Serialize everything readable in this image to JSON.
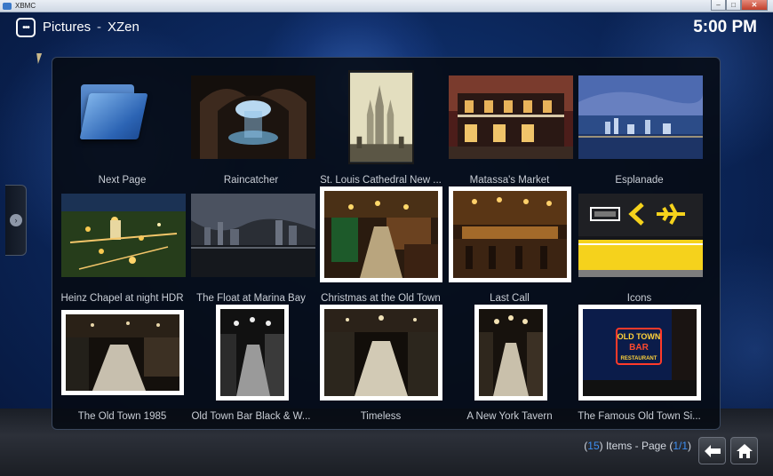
{
  "window": {
    "title": "XBMC",
    "buttons": {
      "minimize": "–",
      "maximize": "□",
      "close": "✕"
    }
  },
  "header": {
    "icon": "pictures-menu-icon",
    "title": "Pictures",
    "separator": "-",
    "subtitle": "XZen",
    "clock": "5:00 PM"
  },
  "colors": {
    "accent": "#3d8ef0",
    "panel": "#060a12",
    "background": "#0b2558"
  },
  "items": [
    {
      "label": "Next Page",
      "type": "folder"
    },
    {
      "label": "Raincatcher"
    },
    {
      "label": "St. Louis Cathedral New ..."
    },
    {
      "label": "Matassa's Market"
    },
    {
      "label": "Esplanade"
    },
    {
      "label": "Heinz Chapel at night HDR"
    },
    {
      "label": "The Float at Marina Bay"
    },
    {
      "label": "Christmas at the Old Town"
    },
    {
      "label": "Last Call"
    },
    {
      "label": "Icons"
    },
    {
      "label": "The Old Town 1985"
    },
    {
      "label": "Old Town Bar Black & W..."
    },
    {
      "label": "Timeless"
    },
    {
      "label": "A New York Tavern"
    },
    {
      "label": "The Famous Old Town Si..."
    }
  ],
  "sign": {
    "line1": "OLD TOWN",
    "line2": "BAR",
    "line3": "RESTAURANT"
  },
  "footer": {
    "open_paren": "(",
    "count": "15",
    "items_text": ") Items - Page (",
    "page": "1/1",
    "close_paren": ")",
    "back_icon": "back-arrow-icon",
    "home_icon": "home-icon"
  }
}
